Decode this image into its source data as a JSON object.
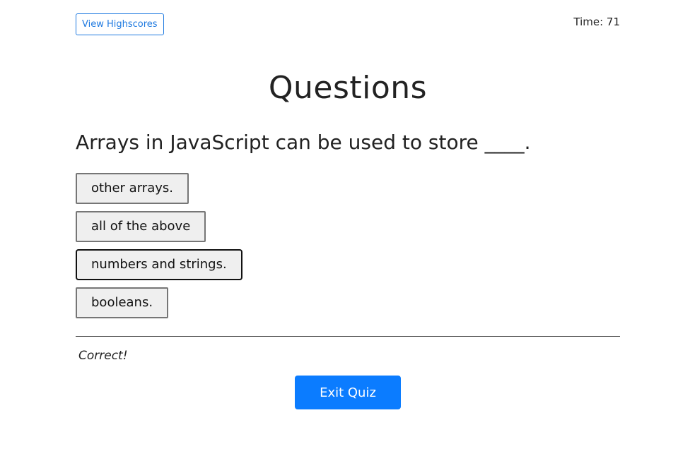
{
  "header": {
    "highscores_label": "View Highscores",
    "timer_text": "Time: 71"
  },
  "main": {
    "title": "Questions",
    "question": "Arrays in JavaScript can be used to store ____.",
    "answers": [
      "other arrays.",
      "all of the above",
      "numbers and strings.",
      "booleans."
    ],
    "feedback": "Correct!",
    "exit_label": "Exit Quiz"
  },
  "colors": {
    "accent": "#0b7cff",
    "link": "#1f7ae0",
    "answer_bg": "#efefef"
  }
}
